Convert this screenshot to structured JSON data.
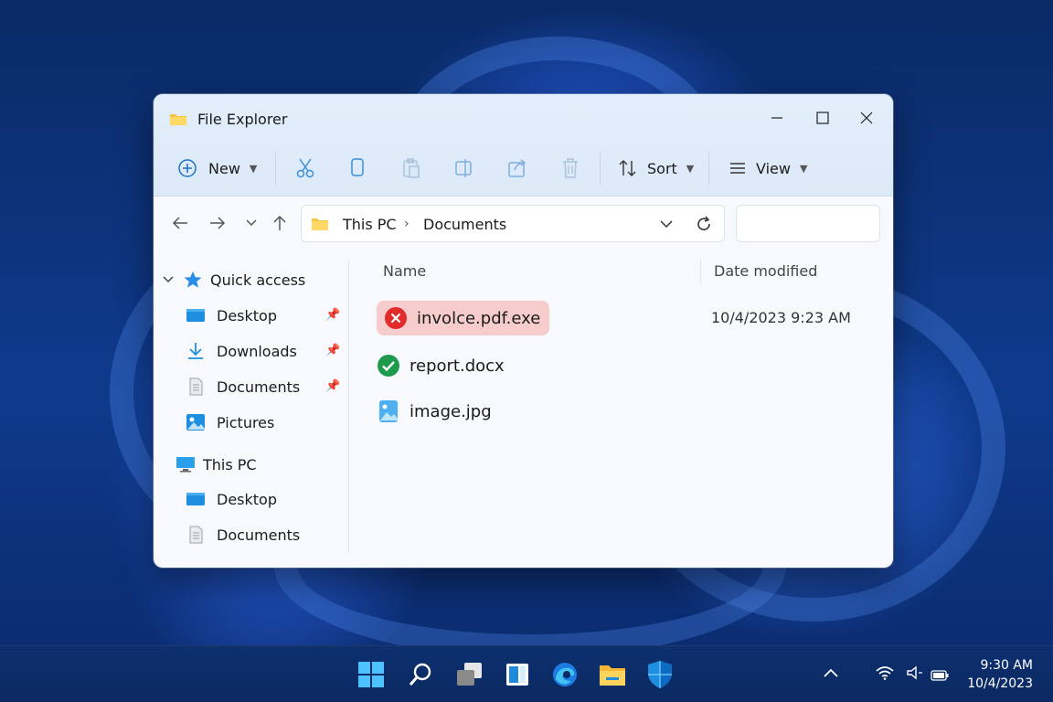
{
  "window": {
    "title": "File Explorer"
  },
  "toolbar": {
    "new_label": "New",
    "sort_label": "Sort",
    "view_label": "View",
    "icons": [
      "cut-icon",
      "copy-icon",
      "paste-icon",
      "rename-icon",
      "share-icon",
      "delete-icon"
    ]
  },
  "address": {
    "segments": [
      "This PC",
      "Documents"
    ],
    "search_placeholder": ""
  },
  "navpane": {
    "quick_access_label": "Quick access",
    "quick_access_items": [
      {
        "label": "Desktop",
        "icon": "desktop-folder-icon",
        "pinned": true
      },
      {
        "label": "Downloads",
        "icon": "download-icon",
        "pinned": true
      },
      {
        "label": "Documents",
        "icon": "document-icon",
        "pinned": true
      },
      {
        "label": "Pictures",
        "icon": "pictures-icon",
        "pinned": false
      }
    ],
    "this_pc_label": "This PC",
    "this_pc_items": [
      {
        "label": "Desktop",
        "icon": "desktop-folder-icon"
      },
      {
        "label": "Documents",
        "icon": "document-icon"
      }
    ]
  },
  "content": {
    "columns": {
      "name": "Name",
      "date": "Date modified"
    },
    "files": [
      {
        "name": "involce.pdf.exe",
        "status": "blocked",
        "status_icon": "error-x-icon",
        "date_modified": "10/4/2023 9:23 AM"
      },
      {
        "name": "report.docx",
        "status": "safe",
        "status_icon": "check-circle-icon",
        "date_modified": ""
      },
      {
        "name": "image.jpg",
        "status": "image",
        "status_icon": "image-file-icon",
        "date_modified": ""
      }
    ]
  },
  "taskbar": {
    "apps": [
      "start-icon",
      "search-icon",
      "task-view-icon",
      "widgets-icon",
      "edge-icon",
      "file-explorer-icon",
      "security-shield-icon"
    ],
    "time": "9:30 AM",
    "date": "10/4/2023"
  },
  "colors": {
    "accent": "#0a64c8",
    "danger": "#e22b2b",
    "success": "#1e9a4c",
    "flag_bg": "#f6cccc",
    "folder_yellow": "#f4c542"
  }
}
